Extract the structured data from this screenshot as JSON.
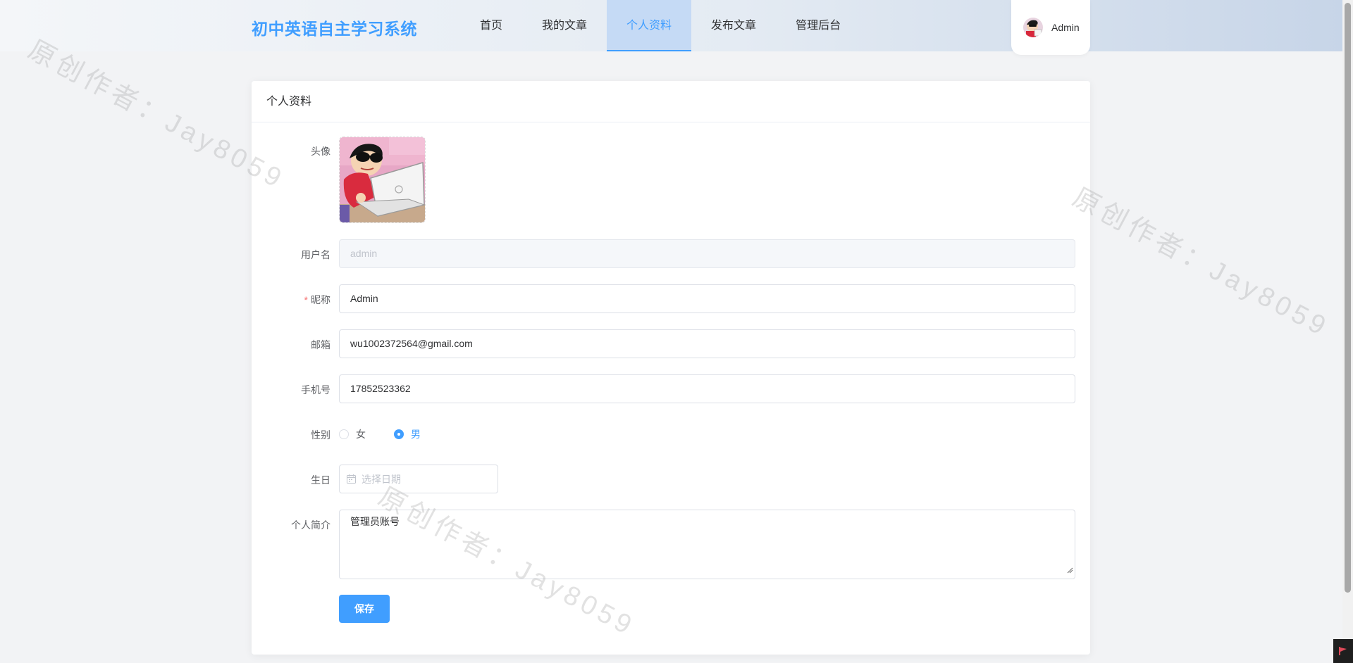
{
  "header": {
    "logo": "初中英语自主学习系统",
    "nav": [
      "首页",
      "我的文章",
      "个人资料",
      "发布文章",
      "管理后台"
    ],
    "active_nav": "个人资料",
    "user_name": "Admin"
  },
  "watermark_text": "原创作者：Jay8059",
  "card": {
    "title": "个人资料",
    "avatar_label": "头像",
    "username_label": "用户名",
    "username_value": "admin",
    "nickname_required_mark": "*",
    "nickname_label": "昵称",
    "nickname_value": "Admin",
    "email_label": "邮箱",
    "email_value": "wu1002372564@gmail.com",
    "phone_label": "手机号",
    "phone_value": "17852523362",
    "gender_label": "性别",
    "gender_options": [
      "女",
      "男"
    ],
    "gender_selected": "男",
    "birthday_label": "生日",
    "birthday_placeholder": "选择日期",
    "bio_label": "个人简介",
    "bio_value": "管理员账号",
    "save_label": "保存"
  },
  "colors": {
    "primary": "#409eff",
    "required": "#f56c6c",
    "nav_active_bg": "#c5daf5"
  }
}
